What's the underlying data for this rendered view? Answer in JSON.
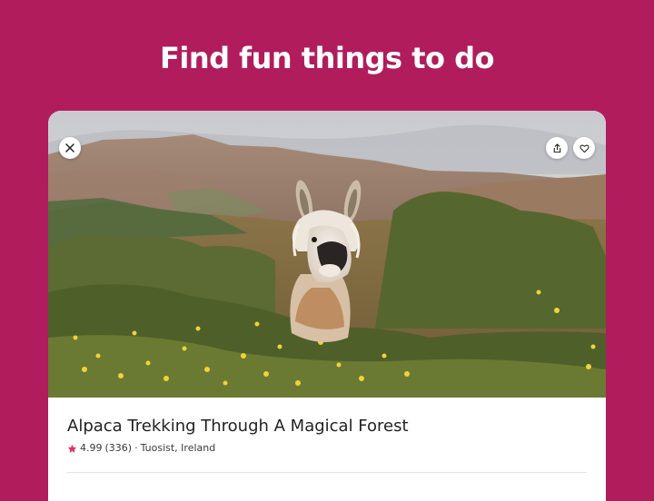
{
  "header": {
    "title": "Find fun things to do"
  },
  "listing": {
    "photo_icon": "alpaca-photo",
    "close_icon": "close-icon",
    "share_icon": "share-icon",
    "save_icon": "heart-icon",
    "title": "Alpaca Trekking Through A Magical Forest",
    "rating": "4.99",
    "reviews": "(336)",
    "separator": "·",
    "location": "Tuosist, Ireland"
  },
  "colors": {
    "background": "#b01c5c",
    "star": "#e0355c",
    "card": "#ffffff"
  }
}
